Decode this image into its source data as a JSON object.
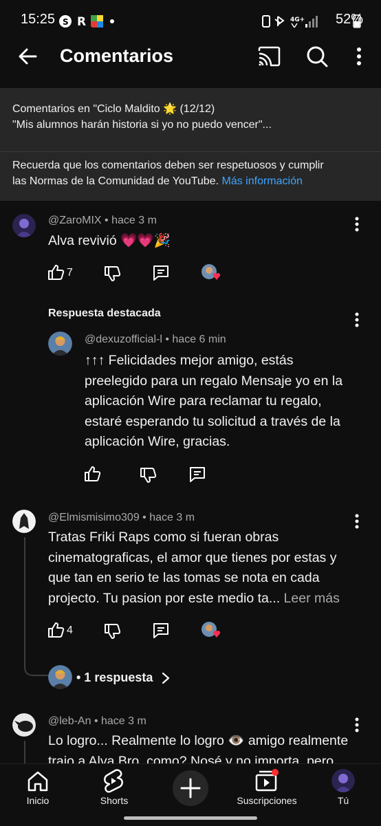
{
  "status_bar": {
    "time": "15:25",
    "battery": "52%",
    "network": "4G+"
  },
  "app_bar": {
    "title": "Comentarios"
  },
  "info": {
    "line1": "Comentarios en \"Ciclo Maldito 🌟 (12/12)",
    "line2": "\"Mis alumnos harán historia si yo no puedo vencer\"...",
    "notice_line1": "Recuerda que los comentarios deben ser respetuosos y cumplir",
    "notice_line2": "las Normas de la Comunidad de YouTube.",
    "notice_link": "Más información"
  },
  "comments": [
    {
      "handle": "@ZaroMIX",
      "time": "hace 3 m",
      "text": "Alva revivió 💗💗🎉",
      "likes": "7"
    },
    {
      "handle": "@Elmismisimo309",
      "time": "hace 3 m",
      "text_lines": [
        "Tratas Friki Raps como si fueran obras",
        "cinematograficas, el amor que tienes por estas y",
        "que tan en serio te las tomas se nota en cada",
        "projecto. Tu pasion por este medio ta..."
      ],
      "read_more": "Leer más",
      "likes": "4",
      "replies_label": "• 1 respuesta"
    },
    {
      "handle": "@leb-An",
      "time": "hace 3 m",
      "text_lines": [
        "Lo logro... Realmente lo logro 👁️ amigo realmente",
        "trajo a Alva Bro, como? Nosé y no importa, pero"
      ]
    }
  ],
  "featured_reply": {
    "label": "Respuesta destacada",
    "handle": "@dexuzofficial-l",
    "time": "hace 6 min",
    "text_lines": [
      "↑↑↑ Felicidades mejor amigo, estás",
      "preelegido para un regalo  Mensaje yo en la",
      "aplicación Wire para reclamar tu regalo,",
      "estaré esperando tu solicitud a través de la",
      "aplicación Wire, gracias."
    ]
  },
  "bottom_nav": {
    "items": [
      "Inicio",
      "Shorts",
      "Suscripciones",
      "Tú"
    ]
  },
  "colors": {
    "background": "#0f0f0f",
    "panel": "#272727",
    "link": "#3ea6ff",
    "heart": "#ff2d55"
  },
  "icons": [
    "back-arrow-icon",
    "cast-icon",
    "search-icon",
    "more-vert-icon",
    "like-icon",
    "dislike-icon",
    "reply-icon",
    "home-icon",
    "shorts-icon",
    "add-icon",
    "subscriptions-icon"
  ]
}
